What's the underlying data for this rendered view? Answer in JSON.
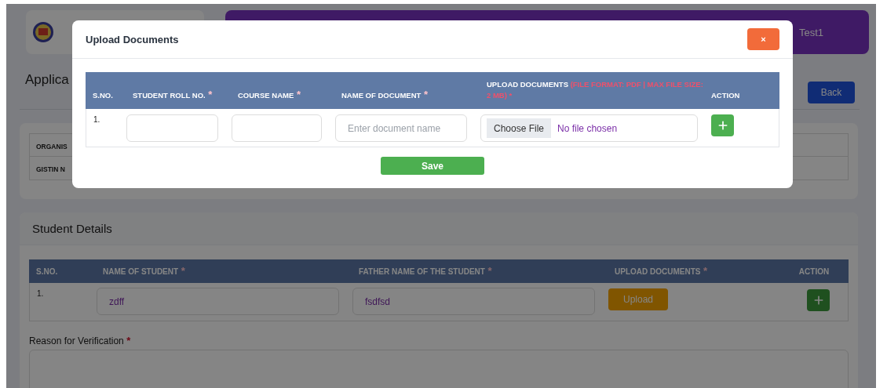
{
  "header": {
    "banner_text": "Test1"
  },
  "page": {
    "title": "Applica",
    "back_button": "Back"
  },
  "organisation_table": {
    "rows": [
      {
        "label": "ORGANIS"
      },
      {
        "label": "GISTIN N"
      }
    ]
  },
  "student_details": {
    "title": "Student Details",
    "columns": [
      {
        "label": "S.NO."
      },
      {
        "label": "NAME OF STUDENT",
        "mark": "*"
      },
      {
        "label": "FATHER NAME OF THE STUDENT",
        "mark": "*"
      },
      {
        "label": "UPLOAD DOCUMENTS",
        "mark": "*"
      },
      {
        "label": "ACTION"
      }
    ],
    "rows": [
      {
        "sno": "1.",
        "student_name": "zdff",
        "father_name": "fsdfsd",
        "upload_button": "Upload"
      }
    ],
    "reason": {
      "label": "Reason for Verification",
      "mark": "*"
    }
  },
  "modal": {
    "title": "Upload Documents",
    "close": "×",
    "columns": [
      {
        "label": "S.NO."
      },
      {
        "label": "STUDENT ROLL NO.",
        "mark": "*"
      },
      {
        "label": "COURSE NAME",
        "mark": "*"
      },
      {
        "label": "NAME OF DOCUMENT",
        "mark": "*"
      },
      {
        "label": "UPLOAD DOCUMENTS",
        "note": "(FILE FORMAT: PDF | MAX FILE SIZE: 2 MB) *"
      },
      {
        "label": "ACTION"
      }
    ],
    "rows": [
      {
        "sno": "1.",
        "document_placeholder": "Enter document name",
        "choose_file": "Choose File",
        "file_status": "No file chosen"
      }
    ],
    "save_button": "Save"
  }
}
